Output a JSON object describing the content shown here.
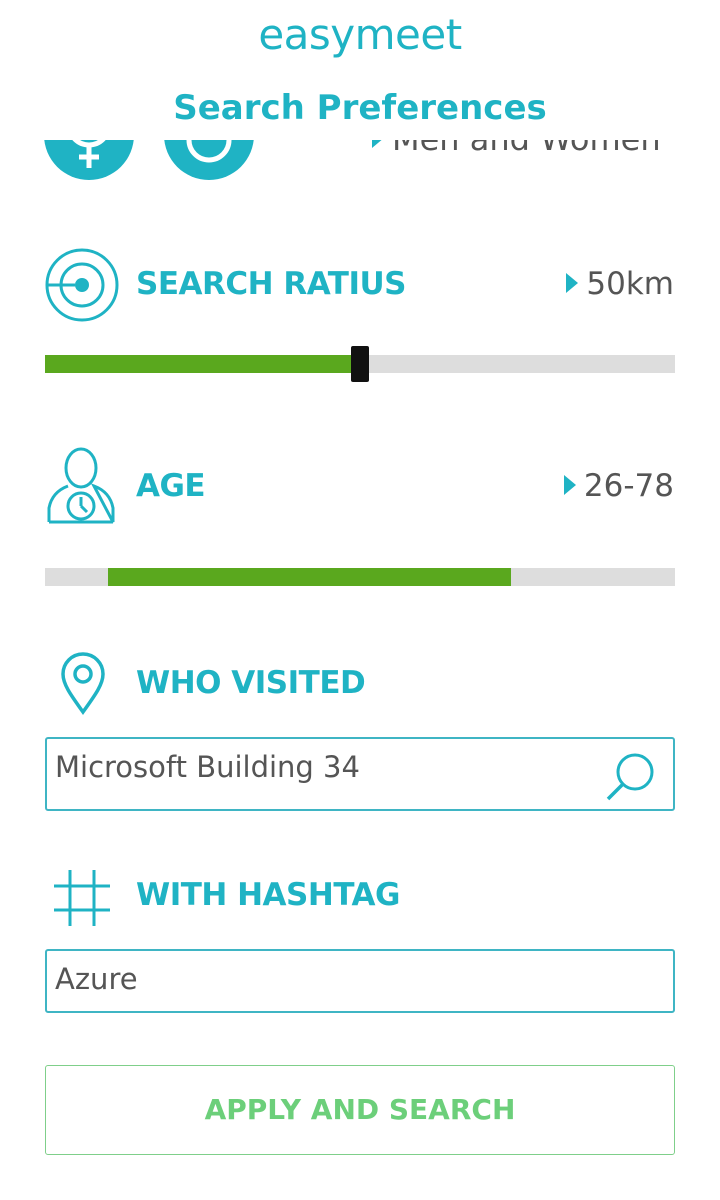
{
  "header": {
    "logo": "easymeet",
    "title": "Search Preferences"
  },
  "gender": {
    "value": "Men and Women"
  },
  "radius": {
    "label": "SEARCH RATIUS",
    "value": "50km",
    "slider_fraction": 0.5
  },
  "age": {
    "label": "AGE",
    "value": "26-78",
    "range_min_fraction": 0.1,
    "range_max_fraction": 0.74
  },
  "visited": {
    "label": "WHO VISITED",
    "input_value": "Microsoft Building 34"
  },
  "hashtag": {
    "label": "WITH HASHTAG",
    "input_value": "Azure"
  },
  "apply_button": {
    "label": "APPLY AND SEARCH"
  },
  "colors": {
    "accent": "#1fb3c4",
    "slider_fill": "#5aa81e",
    "track": "#dddddd",
    "button_text": "#6ccf7a"
  },
  "icons": [
    "female-icon",
    "male-icon",
    "radar-icon",
    "age-person-clock-icon",
    "location-pin-icon",
    "hashtag-icon",
    "search-icon"
  ]
}
